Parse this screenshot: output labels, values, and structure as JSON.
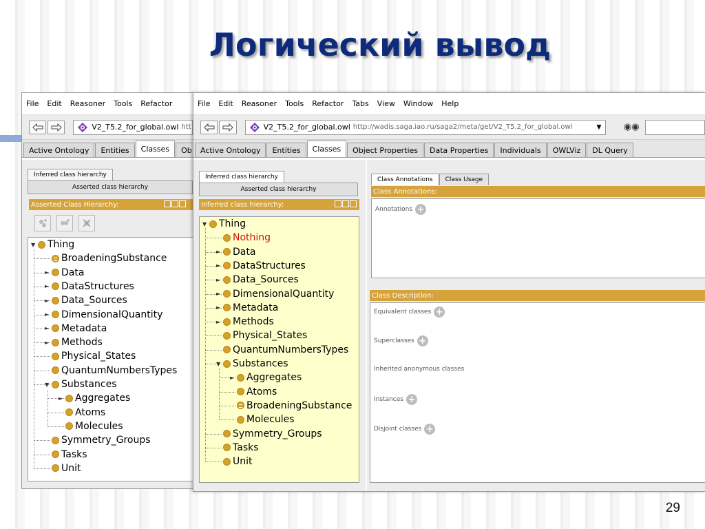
{
  "slide": {
    "title": "Логический вывод",
    "page_number": "29"
  },
  "win1": {
    "menu": [
      "File",
      "Edit",
      "Reasoner",
      "Tools",
      "Refactor"
    ],
    "ontology_name": "V2_T5.2_for_global.owl",
    "ontology_url_fragment": "htt",
    "tabs": [
      "Active Ontology",
      "Entities",
      "Classes",
      "Ob"
    ],
    "active_tab": "Classes",
    "subtab_top": "Inferred class hierarchy",
    "subtab_bottom": "Asserted class hierarchy",
    "header": "Asserted Class Hierarchy:",
    "tree": [
      {
        "label": "Thing",
        "depth": 0,
        "expander": "open",
        "icon": "class-dot"
      },
      {
        "label": "BroadeningSubstance",
        "depth": 1,
        "expander": "none",
        "icon": "defined-class-dot"
      },
      {
        "label": "Data",
        "depth": 1,
        "expander": "closed",
        "icon": "class-dot"
      },
      {
        "label": "DataStructures",
        "depth": 1,
        "expander": "closed",
        "icon": "class-dot"
      },
      {
        "label": "Data_Sources",
        "depth": 1,
        "expander": "closed",
        "icon": "class-dot"
      },
      {
        "label": "DimensionalQuantity",
        "depth": 1,
        "expander": "closed",
        "icon": "class-dot"
      },
      {
        "label": "Metadata",
        "depth": 1,
        "expander": "closed",
        "icon": "class-dot"
      },
      {
        "label": "Methods",
        "depth": 1,
        "expander": "closed",
        "icon": "class-dot"
      },
      {
        "label": "Physical_States",
        "depth": 1,
        "expander": "none",
        "icon": "class-dot"
      },
      {
        "label": "QuantumNumbersTypes",
        "depth": 1,
        "expander": "none",
        "icon": "class-dot"
      },
      {
        "label": "Substances",
        "depth": 1,
        "expander": "open",
        "icon": "class-dot"
      },
      {
        "label": "Aggregates",
        "depth": 2,
        "expander": "closed",
        "icon": "class-dot"
      },
      {
        "label": "Atoms",
        "depth": 2,
        "expander": "none",
        "icon": "class-dot"
      },
      {
        "label": "Molecules",
        "depth": 2,
        "expander": "none",
        "icon": "class-dot"
      },
      {
        "label": "Symmetry_Groups",
        "depth": 1,
        "expander": "none",
        "icon": "class-dot"
      },
      {
        "label": "Tasks",
        "depth": 1,
        "expander": "none",
        "icon": "class-dot"
      },
      {
        "label": "Unit",
        "depth": 1,
        "expander": "none",
        "icon": "class-dot"
      }
    ]
  },
  "win2": {
    "menu": [
      "File",
      "Edit",
      "Reasoner",
      "Tools",
      "Refactor",
      "Tabs",
      "View",
      "Window",
      "Help"
    ],
    "ontology_name": "V2_T5.2_for_global.owl",
    "ontology_url": "http://wadis.saga.iao.ru/saga2/meta/get/V2_T5.2_for_global.owl",
    "tabs": [
      "Active Ontology",
      "Entities",
      "Classes",
      "Object Properties",
      "Data Properties",
      "Individuals",
      "OWLViz",
      "DL Query"
    ],
    "active_tab": "Classes",
    "subtab_top": "Inferred class hierarchy",
    "subtab_bottom": "Asserted class hierarchy",
    "header": "Inferred class hierarchy:",
    "tree": [
      {
        "label": "Thing",
        "depth": 0,
        "expander": "open",
        "icon": "class-dot"
      },
      {
        "label": "Nothing",
        "depth": 1,
        "expander": "none",
        "icon": "class-dot",
        "color": "#d01010"
      },
      {
        "label": "Data",
        "depth": 1,
        "expander": "closed",
        "icon": "class-dot"
      },
      {
        "label": "DataStructures",
        "depth": 1,
        "expander": "closed",
        "icon": "class-dot"
      },
      {
        "label": "Data_Sources",
        "depth": 1,
        "expander": "closed",
        "icon": "class-dot"
      },
      {
        "label": "DimensionalQuantity",
        "depth": 1,
        "expander": "closed",
        "icon": "class-dot"
      },
      {
        "label": "Metadata",
        "depth": 1,
        "expander": "closed",
        "icon": "class-dot"
      },
      {
        "label": "Methods",
        "depth": 1,
        "expander": "closed",
        "icon": "class-dot"
      },
      {
        "label": "Physical_States",
        "depth": 1,
        "expander": "none",
        "icon": "class-dot"
      },
      {
        "label": "QuantumNumbersTypes",
        "depth": 1,
        "expander": "none",
        "icon": "class-dot"
      },
      {
        "label": "Substances",
        "depth": 1,
        "expander": "open",
        "icon": "class-dot"
      },
      {
        "label": "Aggregates",
        "depth": 2,
        "expander": "closed",
        "icon": "class-dot"
      },
      {
        "label": "Atoms",
        "depth": 2,
        "expander": "none",
        "icon": "class-dot"
      },
      {
        "label": "BroadeningSubstance",
        "depth": 2,
        "expander": "none",
        "icon": "defined-class-dot"
      },
      {
        "label": "Molecules",
        "depth": 2,
        "expander": "none",
        "icon": "class-dot"
      },
      {
        "label": "Symmetry_Groups",
        "depth": 1,
        "expander": "none",
        "icon": "class-dot"
      },
      {
        "label": "Tasks",
        "depth": 1,
        "expander": "none",
        "icon": "class-dot"
      },
      {
        "label": "Unit",
        "depth": 1,
        "expander": "none",
        "icon": "class-dot"
      }
    ],
    "annotations": {
      "tab_active": "Class Annotations",
      "tab_other": "Class Usage",
      "header": "Class Annotations:",
      "annotations_label": "Annotations"
    },
    "description": {
      "header": "Class Description:",
      "sections": [
        "Equivalent classes",
        "Superclasses",
        "Inherited anonymous classes",
        "Instances",
        "Disjoint classes"
      ],
      "sections_with_add": [
        true,
        true,
        false,
        true,
        true
      ]
    }
  },
  "colors": {
    "title": "#0d2b7a",
    "header_bar": "#d6a23a",
    "class_dot": "#d4a22b",
    "inferred_tree_bg": "#ffffcc",
    "nothing_text": "#d01010"
  }
}
